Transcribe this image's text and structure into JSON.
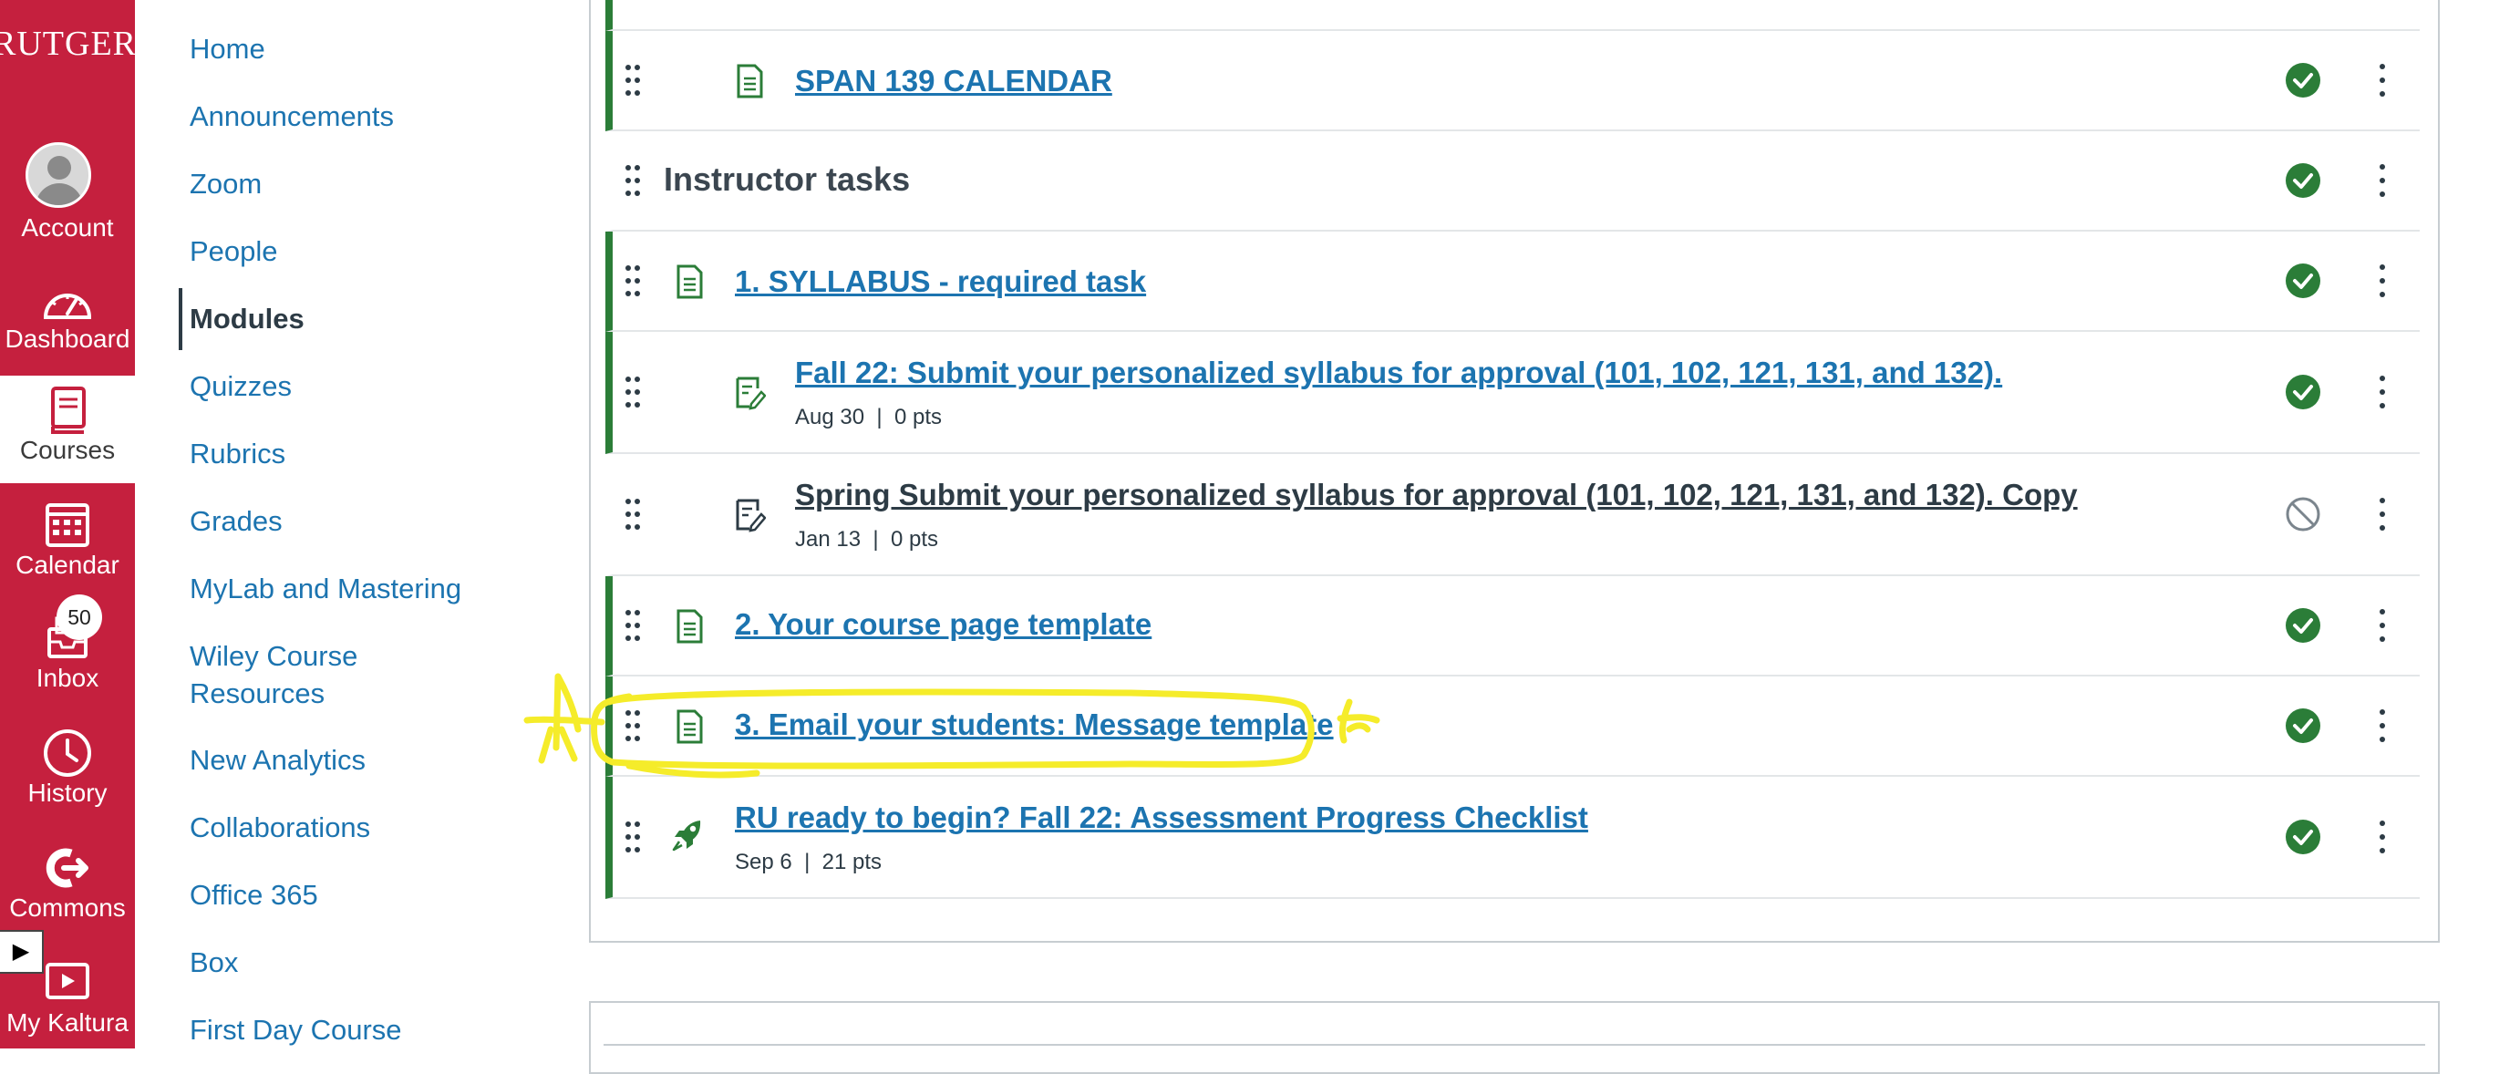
{
  "global_nav": {
    "logo_text": "RUTGERS",
    "items": [
      {
        "label": "Account",
        "icon": "avatar"
      },
      {
        "label": "Dashboard",
        "icon": "dashboard-icon"
      },
      {
        "label": "Courses",
        "icon": "courses-icon"
      },
      {
        "label": "Calendar",
        "icon": "calendar-icon"
      },
      {
        "label": "Inbox",
        "icon": "inbox-icon",
        "badge": "50"
      },
      {
        "label": "History",
        "icon": "history-icon"
      },
      {
        "label": "Commons",
        "icon": "commons-icon"
      },
      {
        "label": "My Kaltura",
        "icon": "kaltura-icon"
      }
    ],
    "active": "Courses",
    "brand_color": "#c5203e"
  },
  "course_nav": {
    "links": [
      "Home",
      "Announcements",
      "Zoom",
      "People",
      "Modules",
      "Quizzes",
      "Rubrics",
      "Grades",
      "MyLab and Mastering",
      "Wiley Course",
      "Resources",
      "New Analytics",
      "Collaborations",
      "Office 365",
      "Box",
      "First Day Course"
    ],
    "active": "Modules",
    "link_color": "#1c74b0"
  },
  "module": {
    "items": [
      {
        "type": "page",
        "title": "SPAN 139 CALENDAR",
        "status": "published"
      },
      {
        "type": "header",
        "title": "Instructor tasks",
        "status": "published"
      },
      {
        "type": "page",
        "title": "1. SYLLABUS - required task",
        "status": "published"
      },
      {
        "type": "assignment",
        "title": "Fall 22: Submit your personalized syllabus for approval (101, 102, 121, 131, and 132).",
        "date": "Aug 30",
        "points": "0 pts",
        "status": "published"
      },
      {
        "type": "assignment",
        "title": "Spring Submit your personalized syllabus for approval (101, 102, 121, 131, and 132). Copy",
        "date": "Jan 13",
        "points": "0 pts",
        "status": "unpublished"
      },
      {
        "type": "page",
        "title": "2. Your course page template",
        "status": "published"
      },
      {
        "type": "page",
        "title": "3. Email your students: Message template",
        "status": "published"
      },
      {
        "type": "quiz",
        "title": "RU ready to begin? Fall 22: Assessment Progress Checklist",
        "date": "Sep 6",
        "points": "21 pts",
        "status": "published"
      }
    ],
    "meta_separator": "|",
    "published_color": "#2b7d38",
    "annotation_color": "#f5ec2a"
  }
}
